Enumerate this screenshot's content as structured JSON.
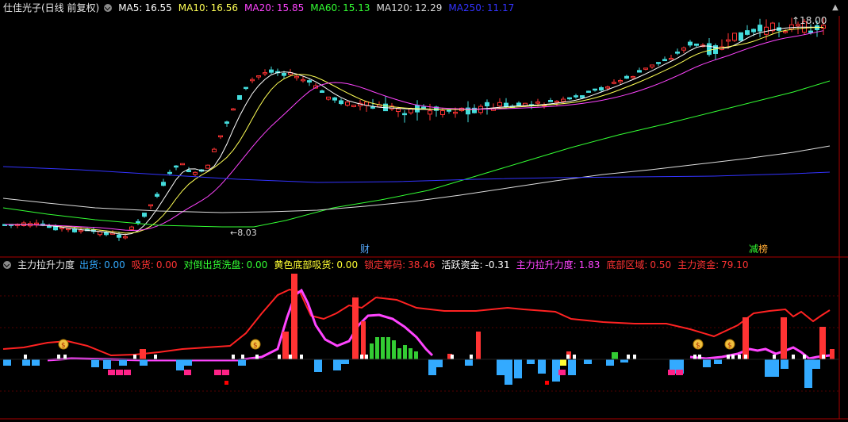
{
  "main_header": {
    "title": "仕佳光子(日线 前复权)",
    "items": [
      {
        "label": "MA5:",
        "value": "16.55",
        "color": "#ffffff"
      },
      {
        "label": "MA10:",
        "value": "16.56",
        "color": "#ffff55"
      },
      {
        "label": "MA20:",
        "value": "15.85",
        "color": "#ff44ff"
      },
      {
        "label": "MA60:",
        "value": "15.13",
        "color": "#33ff33"
      },
      {
        "label": "MA120:",
        "value": "12.29",
        "color": "#dddddd"
      },
      {
        "label": "MA250:",
        "value": "11.17",
        "color": "#3333ff"
      }
    ]
  },
  "price_annotations": {
    "high": "18.00",
    "low": "8.03",
    "markers": [
      {
        "text": "财",
        "color": "#55aaff"
      },
      {
        "text": "减",
        "color": "#33ff33"
      },
      {
        "text": "榜",
        "color": "#ffaa33"
      }
    ]
  },
  "sub_header": {
    "title": "主力拉升力度",
    "items": [
      {
        "label": "出货:",
        "value": "0.00",
        "color": "#33aaff"
      },
      {
        "label": "吸货:",
        "value": "0.00",
        "color": "#ff3333"
      },
      {
        "label": "对倒出货洗盘:",
        "value": "0.00",
        "color": "#33ff33"
      },
      {
        "label": "黄色底部吸货:",
        "value": "0.00",
        "color": "#ffff33"
      },
      {
        "label": "锁定筹码:",
        "value": "38.46",
        "color": "#ff3333"
      },
      {
        "label": "活跃资金:",
        "value": "-0.31",
        "color": "#ffffff"
      },
      {
        "label": "主力拉升力度:",
        "value": "1.83",
        "color": "#ff44ff"
      },
      {
        "label": "底部区域:",
        "value": "0.50",
        "color": "#ff3333"
      },
      {
        "label": "主力资金:",
        "value": "79.10",
        "color": "#ff3333"
      }
    ]
  },
  "colors": {
    "up": "#ff3333",
    "down": "#44dddd",
    "ma5": "#ffffff",
    "ma10": "#ffff55",
    "ma20": "#ff44ff",
    "ma60": "#33ff33",
    "ma120": "#dddddd",
    "ma250": "#3333ff",
    "lock_line": "#ff2222",
    "force_line": "#ff44ff",
    "outflow": "#33aaff",
    "pink": "#ff2288"
  },
  "icons": {
    "collapse": "chevron-down-icon",
    "money_bag": "money-bag-icon"
  }
}
